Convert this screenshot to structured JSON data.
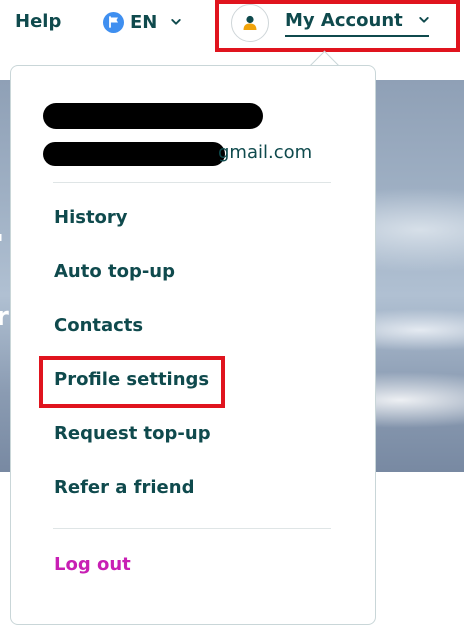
{
  "nav": {
    "help_label": "Help",
    "language_label": "EN",
    "account_label": "My Account"
  },
  "account_menu": {
    "email_suffix": "gmail.com",
    "items": [
      {
        "label": "History"
      },
      {
        "label": "Auto top-up"
      },
      {
        "label": "Contacts"
      },
      {
        "label": "Profile settings"
      },
      {
        "label": "Request top-up"
      },
      {
        "label": "Refer a friend"
      }
    ],
    "logout_label": "Log out"
  },
  "colors": {
    "text": "#0f4a4d",
    "logout": "#c81fb4",
    "highlight": "#e0141e",
    "flag": "#3f8ff0",
    "avatar_person": "#f0a30a"
  },
  "icons": {
    "language": "flag-icon",
    "avatar": "user-icon",
    "dropdown": "chevron-down-icon"
  }
}
